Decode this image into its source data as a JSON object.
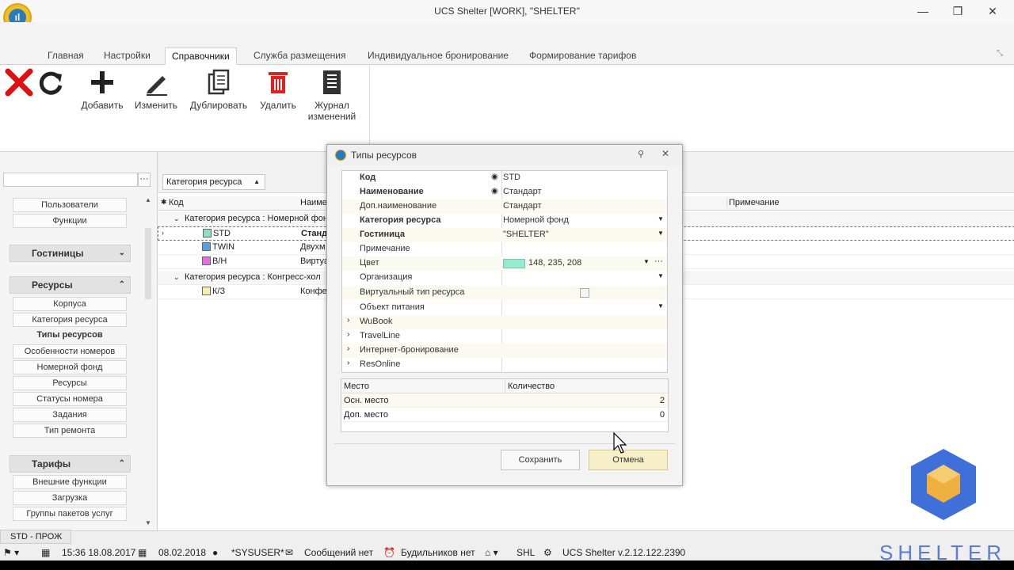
{
  "window": {
    "title": "UCS Shelter [WORK], \"SHELTER\""
  },
  "tabs": [
    "Главная",
    "Настройки",
    "Справочники",
    "Служба размещения",
    "Индивидуальное бронирование",
    "Формирование тарифов"
  ],
  "ribbon": {
    "add": "Добавить",
    "edit": "Изменить",
    "duplicate": "Дублировать",
    "delete": "Удалить",
    "log_line1": "Журнал",
    "log_line2": "изменений"
  },
  "sidebar": {
    "items_top": [
      "Пользователи",
      "Функции"
    ],
    "group_hotels": "Гостиницы",
    "group_resources": "Ресурсы",
    "resources": [
      "Корпуса",
      "Категория ресурса",
      "Типы ресурсов",
      "Особенности номеров",
      "Номерной фонд",
      "Ресурсы",
      "Статусы номера",
      "Задания",
      "Тип ремонта"
    ],
    "group_tariffs": "Тарифы",
    "tariffs": [
      "Внешние функции",
      "Загрузка",
      "Группы пакетов услуг"
    ]
  },
  "grid": {
    "group_chip": "Категория ресурса",
    "col_code": "Код",
    "col_name": "Наимен",
    "col_note": "Примечание",
    "group1": "Категория ресурса : Номерной фон",
    "group2": "Категория ресурса : Конгресс-хол",
    "rows": [
      {
        "code": "STD",
        "name": "Станд",
        "color": "#8ee0c0"
      },
      {
        "code": "TWIN",
        "name": "Двухм",
        "color": "#5aa0e0"
      },
      {
        "code": "В/Н",
        "name": "Виртуа",
        "color": "#e070e0"
      }
    ],
    "row4": {
      "code": "К/З",
      "name": "Конфе",
      "color": "#f8f0a8"
    }
  },
  "dialog": {
    "title": "Типы ресурсов",
    "props": [
      {
        "label": "Код",
        "value": "STD"
      },
      {
        "label": "Наименование",
        "value": "Стандарт"
      },
      {
        "label": "Доп.наименование",
        "value": "Стандарт"
      },
      {
        "label": "Категория ресурса",
        "value": "Номерной фонд"
      },
      {
        "label": "Гостиница",
        "value": "\"SHELTER\""
      },
      {
        "label": "Примечание",
        "value": ""
      },
      {
        "label": "Цвет",
        "value": "148, 235, 208"
      },
      {
        "label": "Организация",
        "value": ""
      },
      {
        "label": "Виртуальный тип ресурса",
        "value": ""
      },
      {
        "label": "Объект питания",
        "value": ""
      },
      {
        "label": "WuBook",
        "value": ""
      },
      {
        "label": "TravelLine",
        "value": ""
      },
      {
        "label": "Интернет-бронирование",
        "value": ""
      },
      {
        "label": "ResOnline",
        "value": ""
      }
    ],
    "places": {
      "col_place": "Место",
      "col_qty": "Количество",
      "rows": [
        {
          "place": "Осн. место",
          "qty": "2"
        },
        {
          "place": "Доп. место",
          "qty": "0"
        }
      ]
    },
    "save": "Сохранить",
    "cancel": "Отмена",
    "swatch_color": "#94ebd0"
  },
  "status": {
    "tab": "STD - ПРОЖ",
    "time": "15:36 18.08.2017",
    "date": "08.02.2018",
    "user": "*SYSUSER*",
    "messages": "Сообщений нет",
    "alarms": "Будильников нет",
    "shl": "SHL",
    "version": "UCS Shelter v.2.12.122.2390"
  },
  "watermark": "SHELTER"
}
